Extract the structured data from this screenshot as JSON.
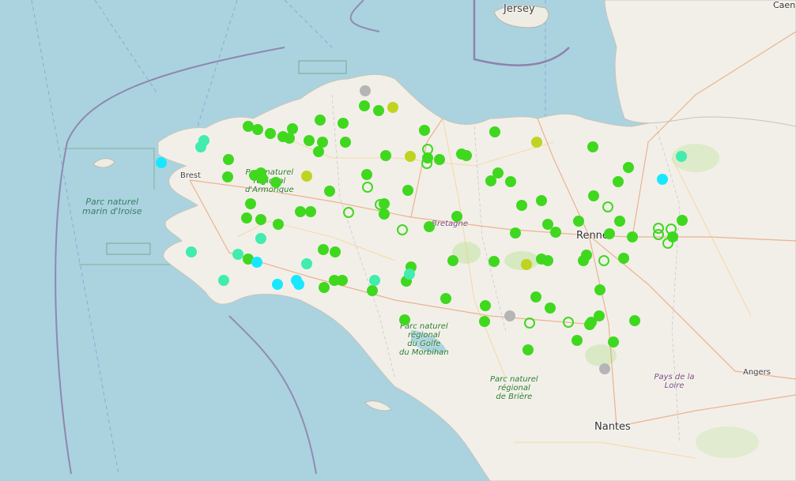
{
  "map": {
    "labels": {
      "brest": "Brest",
      "rennes": "Rennes",
      "nantes": "Nantes",
      "angers": "Angers",
      "caen": "Caen",
      "jersey": "Jersey",
      "bretagne": "Bretagne",
      "pays_de_la_loire": "Pays de la Loire",
      "iroise_line1": "Parc naturel",
      "iroise_line2": "marin d'Iroise",
      "armorique": [
        "Parc naturel",
        "régional",
        "d'Armorique"
      ],
      "morbihan": [
        "Parc naturel",
        "régional",
        "du Golfe",
        "du Morbihan"
      ],
      "briere": [
        "Parc naturel",
        "régional",
        "de Brière"
      ]
    },
    "colors": {
      "sea": "#aad3df",
      "land": "#f2efe9",
      "green_marker": "#3fd81f",
      "ring_marker": "#3fd81f",
      "cyan_marker": "#18e8ff",
      "mint_marker": "#41ecae",
      "olive_marker": "#bfd320",
      "gray_marker": "#b5b5b5"
    },
    "marker_counts": {
      "filled_green": 120,
      "ring_green": 14,
      "cyan": 6,
      "mint": 8,
      "olive": 5,
      "gray": 3
    }
  }
}
